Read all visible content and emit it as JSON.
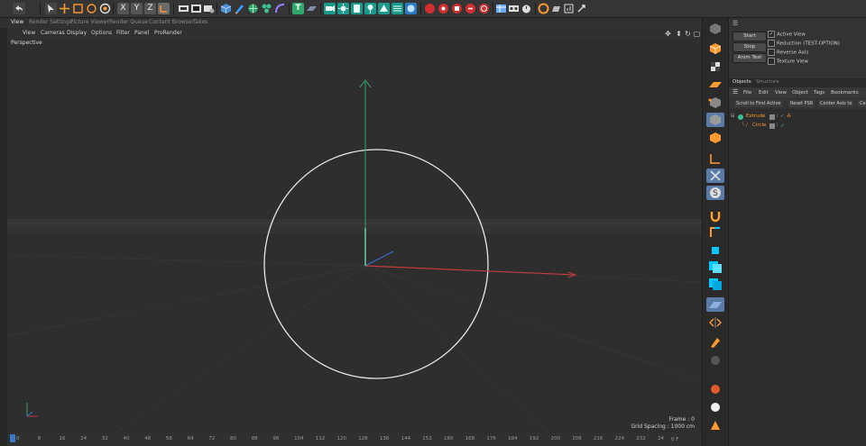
{
  "toolbar": {
    "icons": [
      "undo-icon",
      "select-icon",
      "move-icon",
      "scale-icon",
      "rotate-icon",
      "recent-icon",
      "x-axis-lock-icon",
      "y-axis-lock-icon",
      "z-axis-lock-icon",
      "coordinate-system-icon",
      "render-view-icon",
      "render-picture-viewer-icon",
      "render-settings-icon",
      "cube-icon",
      "pen-icon",
      "subdivision-icon",
      "cloner-icon",
      "deformer-icon",
      "floor-icon",
      "camera-icon",
      "light-icon",
      "text-icon",
      "tag-icon",
      "pin-icon",
      "effector-icon",
      "field-icon",
      "record-icon",
      "keyframe-icon",
      "layout-icon",
      "snap-icon",
      "help-icon"
    ],
    "axis_labels": {
      "x": "X",
      "y": "Y",
      "z": "Z"
    },
    "text_icon_label": "T"
  },
  "tabs": [
    "View",
    "Render Settings",
    "Picture Viewer",
    "Render Queue",
    "Content Browser",
    "Takes"
  ],
  "viewport_menu": [
    "View",
    "Cameras",
    "Display",
    "Options",
    "Filter",
    "Panel",
    "ProRender"
  ],
  "viewport": {
    "name": "Perspective",
    "frame": "Frame : 0",
    "grid_spacing": "Grid Spacing : 1000 cm"
  },
  "ruler": {
    "ticks": [
      "0",
      "8",
      "16",
      "24",
      "32",
      "40",
      "48",
      "56",
      "64",
      "72",
      "80",
      "88",
      "96",
      "104",
      "112",
      "120",
      "128",
      "136",
      "144",
      "152",
      "160",
      "168",
      "176",
      "184",
      "192",
      "200",
      "208",
      "216",
      "224",
      "232",
      "24"
    ],
    "end_label": "0 F"
  },
  "attributes": {
    "buttons": [
      "Start",
      "Stop",
      "Anim Test"
    ],
    "checkboxes": [
      {
        "label": "Active View",
        "checked": true
      },
      {
        "label": "Reduction (TEST-OPTION)",
        "checked": false
      },
      {
        "label": "Reverse Axis",
        "checked": false
      },
      {
        "label": "Texture View",
        "checked": false
      }
    ]
  },
  "objects_panel": {
    "tabs": [
      "Objects",
      "Structure"
    ],
    "menu": [
      "File",
      "Edit",
      "View",
      "Object",
      "Tags",
      "Bookmarks"
    ],
    "tools": [
      "Scroll to First Active",
      "Reset PSR",
      "Center Axis to",
      "Ce"
    ],
    "tree": [
      {
        "name": "Extrude",
        "color": "#ff9a2e"
      },
      {
        "name": "Circle",
        "color": "#ff9a2e"
      }
    ]
  },
  "colors": {
    "accent": "#5a7ba8",
    "axis_x": "#c33b3b",
    "axis_y": "#3ca06a",
    "axis_z": "#3a6fc8",
    "selected_object": "#ff9a2e"
  }
}
